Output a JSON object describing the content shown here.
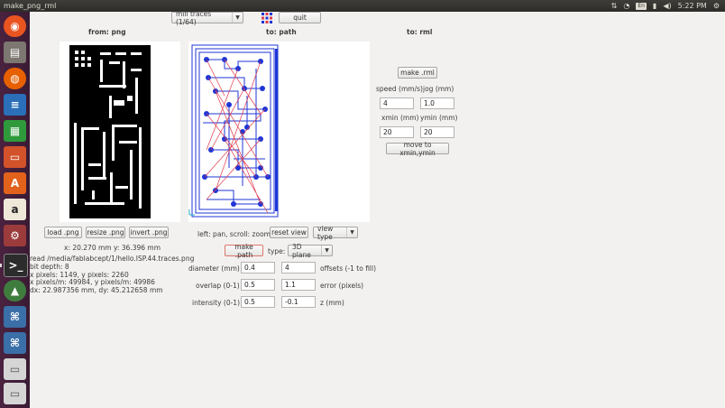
{
  "window": {
    "title": "make_png_rml"
  },
  "tray": {
    "keyboard": "En",
    "time": "5:22 PM"
  },
  "toolbar": {
    "mode_value": "mill traces (1/64)",
    "quit_label": "quit"
  },
  "columns": {
    "from_title": "from: png",
    "to_path_title": "to: path",
    "to_rml_title": "to: rml"
  },
  "png_panel": {
    "load_label": "load .png",
    "resize_label": "resize .png",
    "invert_label": "invert .png",
    "cursor_xy": "x: 20.270 mm  y: 36.396 mm",
    "info": [
      "read /media/fablabcept/1/hello.ISP.44.traces.png",
      "  bit depth: 8",
      "  x pixels: 1149, y pixels: 2260",
      "  x pixels/m: 49984, y pixels/m: 49986",
      "  dx: 22.987356 mm, dy: 45.212658 mm"
    ]
  },
  "path_panel": {
    "hint": "left: pan, scroll: zoom",
    "reset_view_label": "reset view",
    "view_type_value": "view type",
    "make_path_label": "make .path",
    "type_label": "type:",
    "type_value": "3D plane",
    "diameter_label": "diameter (mm)",
    "diameter_value": "0.4",
    "offsets_value": "4",
    "offsets_label": "offsets (-1 to fill)",
    "overlap_label": "overlap (0-1)",
    "overlap_value": "0.5",
    "error_value": "1.1",
    "error_label": "error (pixels)",
    "intensity_label": "intensity (0-1)",
    "intensity_value": "0.5",
    "z_value": "-0.1",
    "z_label": "z (mm)"
  },
  "rml_panel": {
    "make_rml_label": "make .rml",
    "speed_label": "speed (mm/s)",
    "jog_label": "jog (mm)",
    "speed_value": "4",
    "jog_value": "1.0",
    "xmin_label": "xmin (mm)",
    "ymin_label": "ymin (mm)",
    "xmin_value": "20",
    "ymin_value": "20",
    "move_label": "move to xmin,ymin"
  },
  "colors": {
    "path_blue": "#1f35d6",
    "path_red": "#e0394a",
    "accent_focus": "#e0756a"
  }
}
